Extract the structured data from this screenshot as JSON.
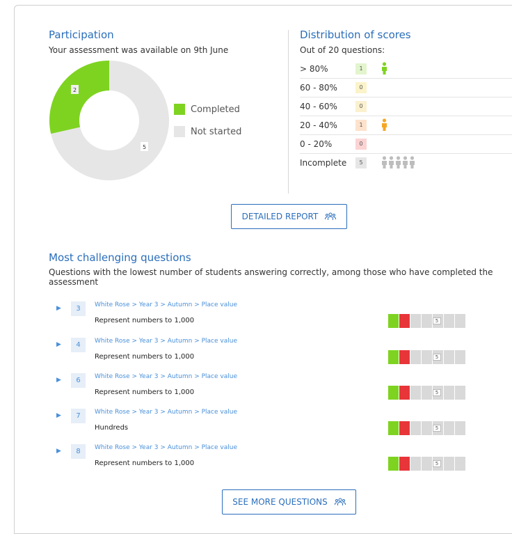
{
  "colors": {
    "accent": "#2a6ebb",
    "completed": "#7ed321",
    "not_started": "#e6e6e6",
    "incorrect": "#e8353a"
  },
  "participation": {
    "title": "Participation",
    "subtitle": "Your assessment was available on 9th June",
    "completed_count": "2",
    "not_started_count": "5",
    "legend_completed": "Completed",
    "legend_not_started": "Not started"
  },
  "distribution": {
    "title": "Distribution of scores",
    "subtitle": "Out of 20 questions:",
    "rows": [
      {
        "label": "> 80%",
        "count": "1",
        "bg": "#e3f5cc",
        "icon_color": "#7ed321"
      },
      {
        "label": "60 - 80%",
        "count": "0",
        "bg": "#fbf3c9",
        "icon_color": ""
      },
      {
        "label": "40 - 60%",
        "count": "0",
        "bg": "#fbf1cf",
        "icon_color": ""
      },
      {
        "label": "20 - 40%",
        "count": "1",
        "bg": "#fde2cc",
        "icon_color": "#f5a623"
      },
      {
        "label": "0 - 20%",
        "count": "0",
        "bg": "#fbd3d3",
        "icon_color": ""
      },
      {
        "label": "Incomplete",
        "count": "5",
        "bg": "#e6e6e6",
        "icon_color": "#bdbdbd"
      }
    ]
  },
  "report_button": {
    "label": "DETAILED REPORT",
    "icon": "people-icon"
  },
  "challenging": {
    "title": "Most challenging questions",
    "subtitle": "Questions with the lowest number of students answering correctly, among those who have completed the assessment",
    "questions": [
      {
        "number": "3",
        "path": "White Rose > Year 3 > Autumn > Place value",
        "name": "Represent numbers to 1,000",
        "incomplete": "5"
      },
      {
        "number": "4",
        "path": "White Rose > Year 3 > Autumn > Place value",
        "name": "Represent numbers to 1,000",
        "incomplete": "5"
      },
      {
        "number": "6",
        "path": "White Rose > Year 3 > Autumn > Place value",
        "name": "Represent numbers to 1,000",
        "incomplete": "5"
      },
      {
        "number": "7",
        "path": "White Rose > Year 3 > Autumn > Place value",
        "name": "Hundreds",
        "incomplete": "5"
      },
      {
        "number": "8",
        "path": "White Rose > Year 3 > Autumn > Place value",
        "name": "Represent numbers to 1,000",
        "incomplete": "5"
      }
    ]
  },
  "more_button": {
    "label": "SEE MORE QUESTIONS",
    "icon": "people-icon"
  }
}
